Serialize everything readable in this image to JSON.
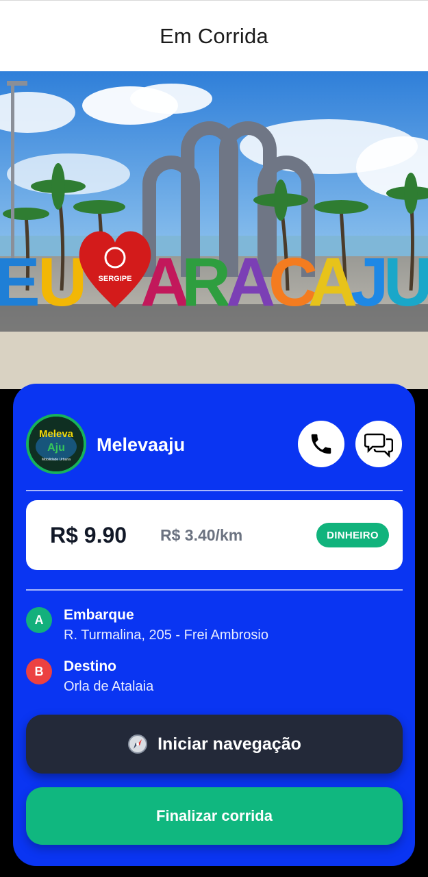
{
  "header": {
    "title": "Em Corrida"
  },
  "banner": {
    "letters": [
      "E",
      "U",
      "A",
      "R",
      "A",
      "C",
      "A",
      "J",
      "U"
    ],
    "heart_text": "SERGIPE",
    "letter_colors": [
      "#1f7fd6",
      "#f2b705",
      "#c2185b",
      "#2e9e3f",
      "#7b3fb5",
      "#f47c20",
      "#e7c31a",
      "#1e88e5",
      "#1aa7c9"
    ]
  },
  "driver": {
    "name": "Melevaaju",
    "avatar_text_top": "Meleva",
    "avatar_text_bottom": "Aju",
    "avatar_tagline": "Mobilidade Urbana"
  },
  "actions": {
    "phone_icon": "phone-icon",
    "chat_icon": "chat-icon"
  },
  "fare": {
    "total": "R$ 9.90",
    "per_km": "R$ 3.40/km",
    "payment": "DINHEIRO"
  },
  "route": {
    "pickup": {
      "marker": "A",
      "title": "Embarque",
      "address": "R. Turmalina, 205 - Frei Ambrosio"
    },
    "dropoff": {
      "marker": "B",
      "title": "Destino",
      "address": "Orla de Atalaia"
    }
  },
  "buttons": {
    "navigate_label": "Iniciar navegação",
    "navigate_icon": "compass-icon",
    "finish_label": "Finalizar corrida"
  },
  "colors": {
    "card_bg": "#0a35f2",
    "accent_green": "#10b77f",
    "marker_red": "#ec4141",
    "nav_button_bg": "#232939"
  }
}
